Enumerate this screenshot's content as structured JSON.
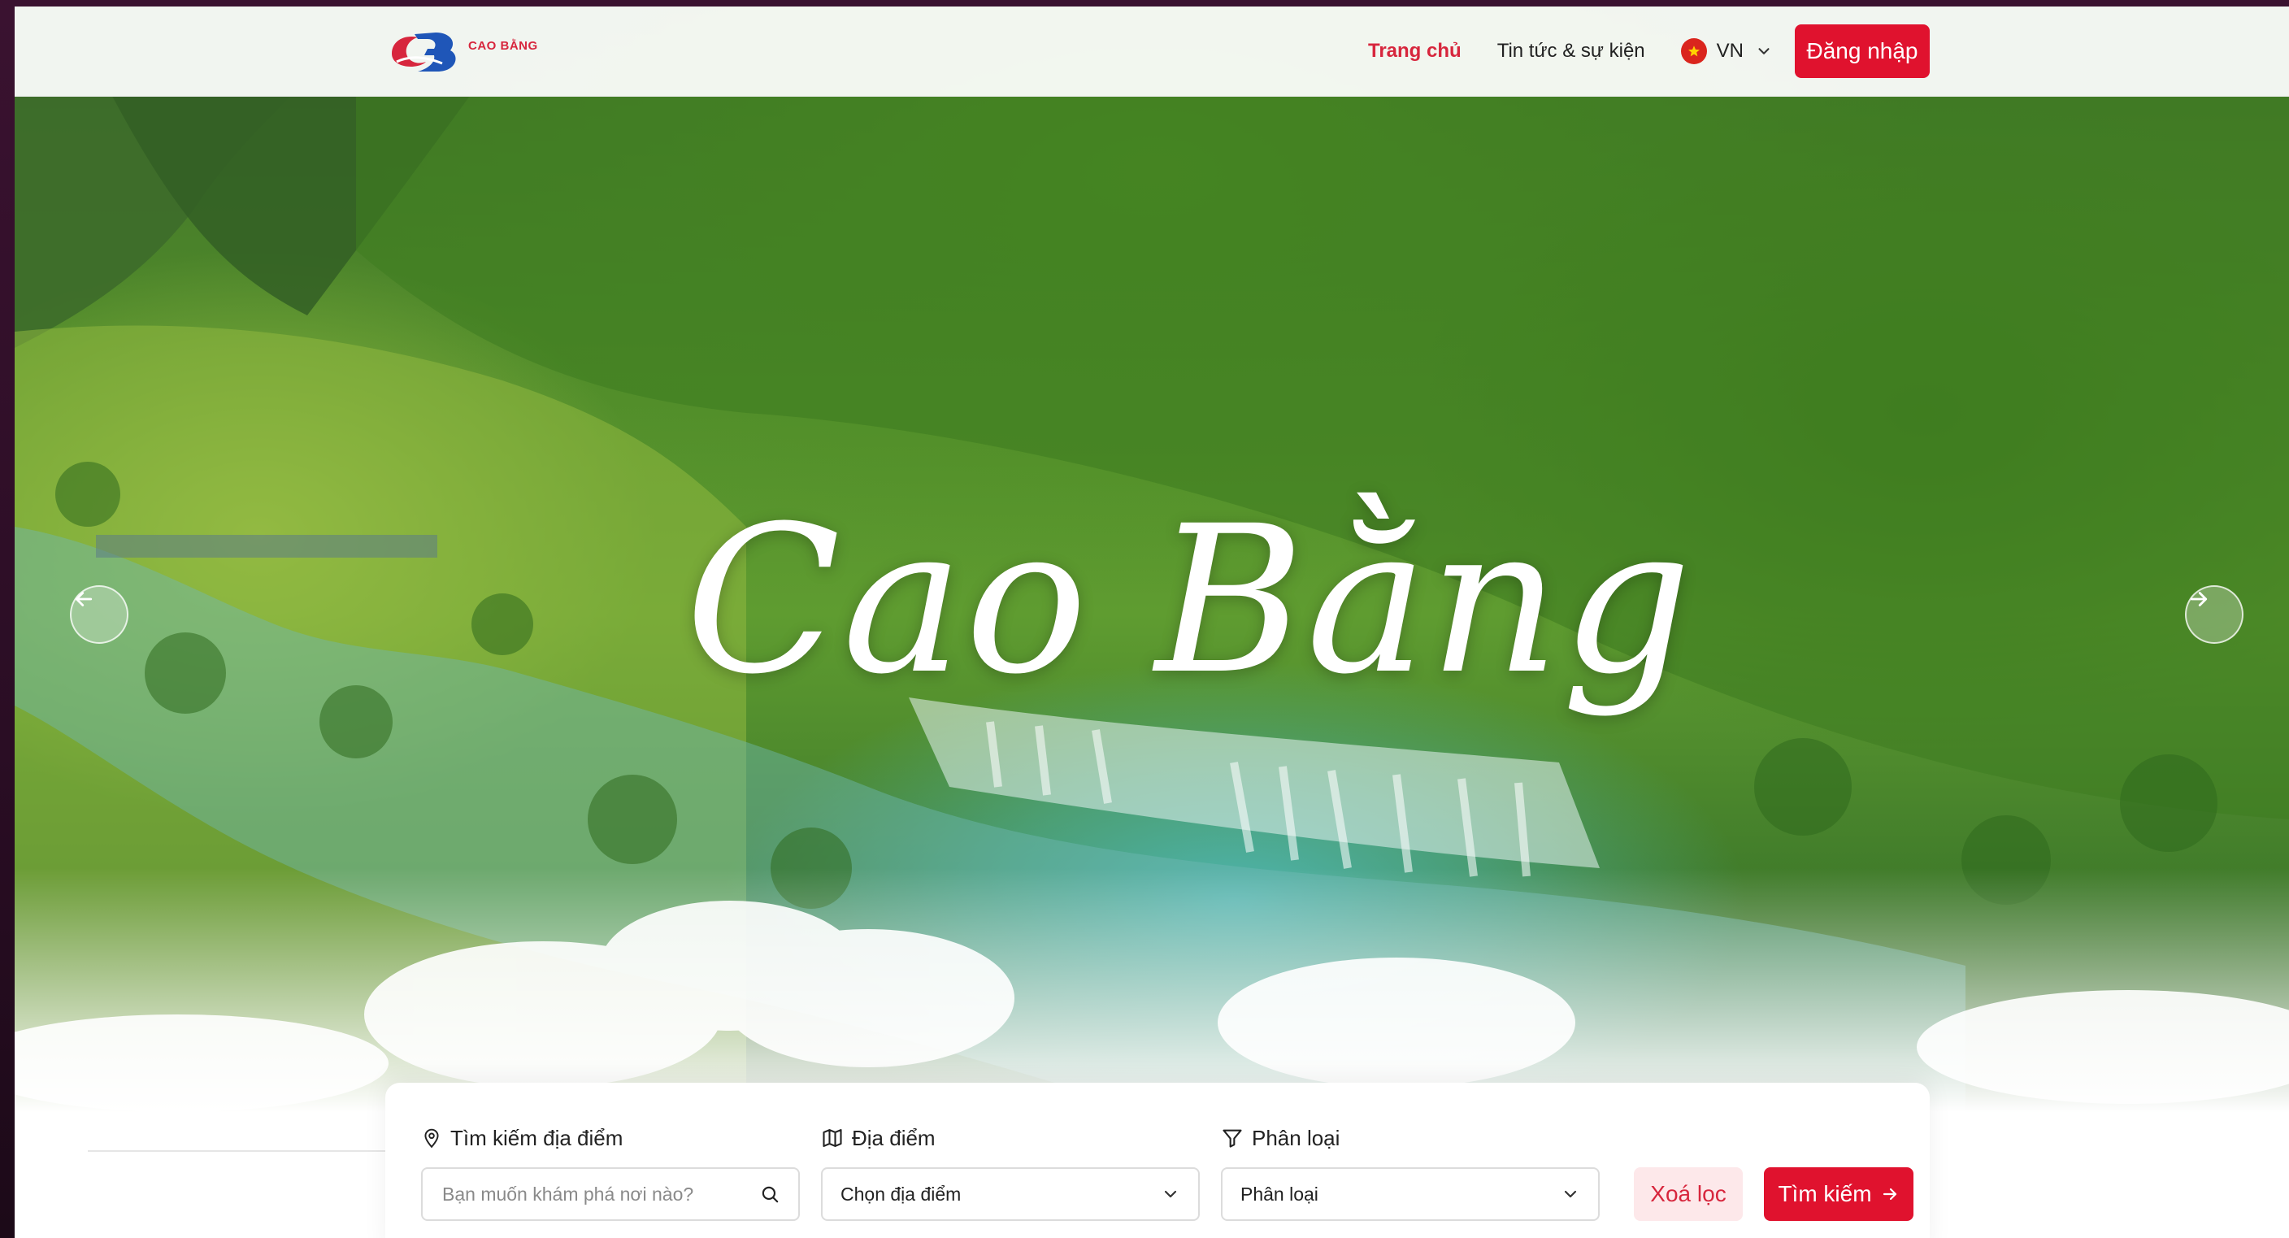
{
  "header": {
    "logo_text": "CAO BẰNG",
    "nav": [
      {
        "label": "Trang chủ",
        "active": true
      },
      {
        "label": "Tin tức & sự kiện",
        "active": false
      }
    ],
    "language": {
      "code": "VN",
      "flag_icon": "vietnam-flag-icon"
    },
    "login_label": "Đăng nhập"
  },
  "hero": {
    "title": "Cao Bằng",
    "prev_icon": "arrow-left-icon",
    "next_icon": "arrow-right-icon"
  },
  "search": {
    "location_search": {
      "label": "Tìm kiếm địa điểm",
      "placeholder": "Bạn muốn khám phá nơi nào?",
      "icon": "map-pin-icon"
    },
    "place": {
      "label": "Địa điểm",
      "value": "Chọn địa điểm",
      "icon": "map-icon"
    },
    "category": {
      "label": "Phân loại",
      "value": "Phân loại",
      "icon": "filter-icon"
    },
    "clear_label": "Xoá lọc",
    "search_label": "Tìm kiếm"
  },
  "colors": {
    "accent": "#e0122e",
    "accent_soft": "#fde8ea",
    "active_nav": "#d7263d"
  }
}
